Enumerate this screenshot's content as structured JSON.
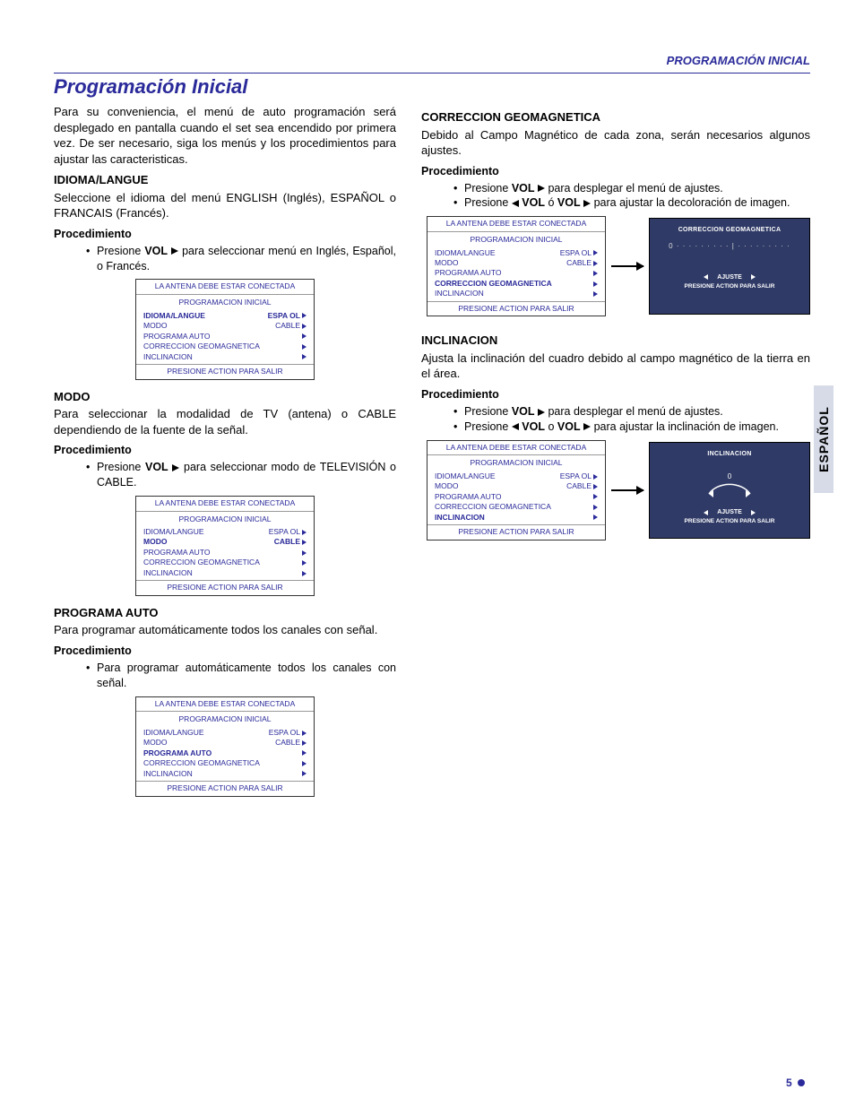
{
  "header": {
    "running_head": "PROGRAMACIÓN INICIAL",
    "title": "Programación Inicial"
  },
  "side_tab": "ESPAÑOL",
  "page_number": "5",
  "left": {
    "intro": "Para su conveniencia, el menú de auto programación será desplegado en pantalla cuando el set sea encendido por primera vez. De ser necesario, siga los menús y los procedimientos para ajustar las caracteristicas.",
    "idioma": {
      "head": "IDIOMA/LANGUE",
      "body": "Seleccione el idioma del menú ENGLISH (Inglés), ESPAÑOL o FRANCAIS (Francés).",
      "proc_head": "Procedimiento",
      "b1a": "Presione ",
      "b1b": "VOL",
      "b1c": " para seleccionar menú en Inglés, Español, o Francés."
    },
    "modo": {
      "head": "MODO",
      "body": "Para seleccionar la modalidad de TV (antena) o CABLE dependiendo de la fuente de la señal.",
      "proc_head": "Procedimiento",
      "b1a": "Presione ",
      "b1b": "VOL",
      "b1c": " para seleccionar modo de TELEVISIÓN o CABLE."
    },
    "programa": {
      "head": "PROGRAMA  AUTO",
      "body": "Para programar automáticamente todos los canales con señal.",
      "proc_head": "Procedimiento",
      "b1": "Para programar automáticamente todos los canales con señal."
    }
  },
  "right": {
    "geo": {
      "head": "CORRECCION GEOMAGNETICA",
      "body": "Debido al Campo Magnético de cada zona, serán necesarios algunos ajustes.",
      "proc_head": "Procedimiento",
      "b1a": "Presione  ",
      "b1b": "VOL",
      "b1c": " para desplegar el menú de ajustes.",
      "b2a": "Presione ",
      "b2b": "VOL",
      "b2c": " ó ",
      "b2d": "VOL",
      "b2e": "  para ajustar la decoloración de imagen."
    },
    "incl": {
      "head": "INCLINACION",
      "body": "Ajusta la inclinación del cuadro debido al campo magnético de la tierra en el área.",
      "proc_head": "Procedimiento",
      "b1a": "Presione ",
      "b1b": "VOL",
      "b1c": " para desplegar  el menú de ajustes.",
      "b2a": "Presione ",
      "b2b": "VOL",
      "b2c": " o ",
      "b2d": "VOL",
      "b2e": " para ajustar la inclinación de imagen."
    }
  },
  "osd": {
    "warn": "LA  ANTENA DEBE ESTAR CONECTADA",
    "title": "PROGRAMACION INICIAL",
    "rows": {
      "idioma": "IDIOMA/LANGUE",
      "idioma_val": "ESPA OL",
      "modo": "MODO",
      "modo_val": "CABLE",
      "programa": "PROGRAMA  AUTO",
      "geo": "CORRECCION GEOMAGNETICA",
      "incl": "INCLINACION"
    },
    "foot": "PRESIONE ACTION PARA SALIR"
  },
  "dark_geo": {
    "title": "CORRECCION GEOMAGNETICA",
    "dots": "0 · · · · · · · · · | · · · · · · · · ·",
    "ajuste": "AJUSTE",
    "exit": "PRESIONE ACTION PARA SALIR"
  },
  "dark_incl": {
    "title": "INCLINACION",
    "zero": "0",
    "ajuste": "AJUSTE",
    "exit": "PRESIONE  ACTION PARA  SALIR"
  }
}
